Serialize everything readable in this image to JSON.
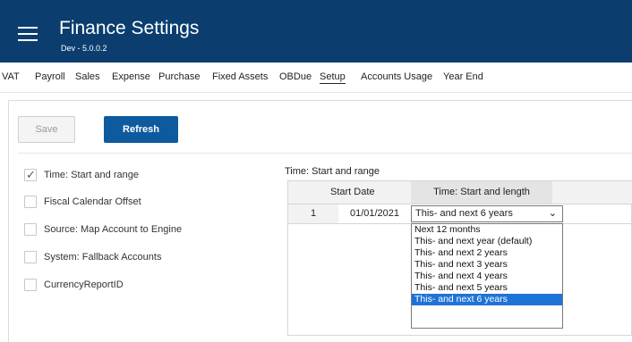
{
  "header": {
    "title": "Finance Settings",
    "version": "Dev - 5.0.0.2",
    "bg_color": "#0b3e6f"
  },
  "nav": {
    "items": [
      "VAT",
      "Payroll",
      "Sales",
      "Expense",
      "Purchase",
      "Fixed Assets",
      "OBDue",
      "Setup",
      "Accounts Usage",
      "Year End"
    ],
    "active": "Setup"
  },
  "toolbar": {
    "save_label": "Save",
    "refresh_label": "Refresh",
    "accent": "#0d5a9e"
  },
  "checklist": [
    {
      "label": "Time: Start and range",
      "checked": true
    },
    {
      "label": "Fiscal Calendar Offset",
      "checked": false
    },
    {
      "label": "Source: Map Account to Engine",
      "checked": false
    },
    {
      "label": "System: Fallback Accounts",
      "checked": false
    },
    {
      "label": "CurrencyReportID",
      "checked": false
    }
  ],
  "grid": {
    "title": "Time: Start and range",
    "columns": [
      "Start Date",
      "Time: Start and length"
    ],
    "rows": [
      {
        "num": "1",
        "start_date": "01/01/2021",
        "time": "This- and next 6 years"
      }
    ]
  },
  "dropdown": {
    "options": [
      "Next 12 months",
      "This- and next year (default)",
      "This- and next 2 years",
      "This- and next 3 years",
      "This- and next 4 years",
      "This- and next 5 years",
      "This- and next 6 years"
    ],
    "selected": "This- and next 6 years",
    "highlight_color": "#1e73d6"
  }
}
